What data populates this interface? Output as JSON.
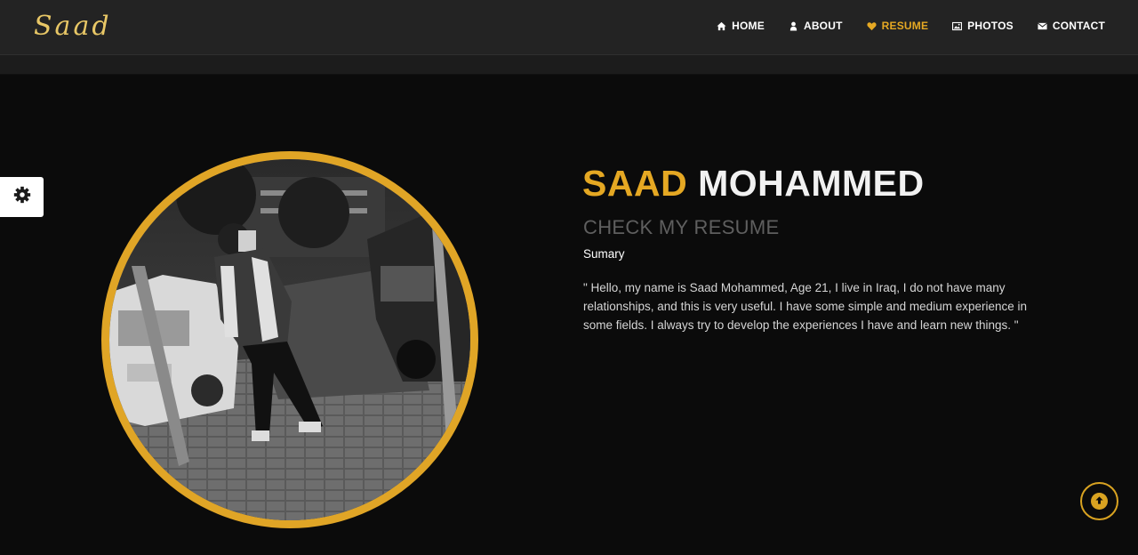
{
  "header": {
    "logo": "Saad",
    "nav": [
      {
        "label": "HOME",
        "icon": "home-icon"
      },
      {
        "label": "ABOUT",
        "icon": "user-icon"
      },
      {
        "label": "RESUME",
        "icon": "heart-icon",
        "active": true
      },
      {
        "label": "PHOTOS",
        "icon": "image-icon"
      },
      {
        "label": "CONTACT",
        "icon": "envelope-icon"
      }
    ]
  },
  "settings": {
    "icon": "gear-icon"
  },
  "profile": {
    "first_name": "SAAD",
    "last_name": "MOHAMMED",
    "subtitle": "CHECK MY RESUME",
    "summary_label": "Sumary",
    "summary_text": "\" Hello, my name is Saad Mohammed, Age 21, I live in Iraq, I do not have many relationships, and this is very useful. I have some simple and medium experience in some fields. I always try to develop the experiences I have and learn new things. \""
  },
  "scroll_top": {
    "icon": "arrow-up-icon"
  },
  "colors": {
    "accent": "#e5a823",
    "header_bg": "#232323",
    "page_bg": "#0b0b0b"
  }
}
